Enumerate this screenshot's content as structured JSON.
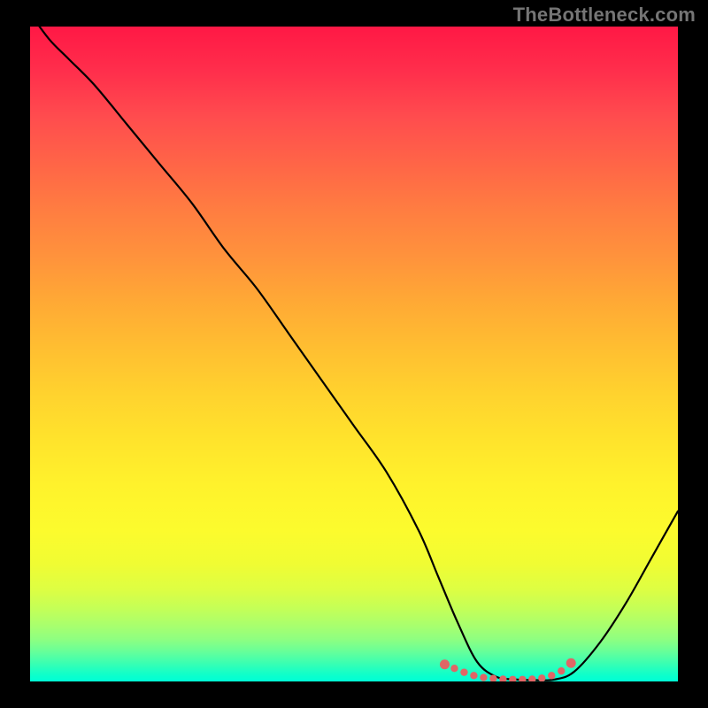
{
  "watermark": "TheBottleneck.com",
  "chart_data": {
    "type": "line",
    "title": "",
    "xlabel": "",
    "ylabel": "",
    "xlim": [
      0,
      100
    ],
    "ylim": [
      0,
      100
    ],
    "grid": false,
    "legend": false,
    "series": [
      {
        "name": "bottleneck-curve",
        "x": [
          0,
          3,
          6,
          10,
          15,
          20,
          25,
          30,
          35,
          40,
          45,
          50,
          55,
          60,
          63,
          66,
          69,
          72,
          75,
          78,
          81,
          84,
          88,
          92,
          96,
          100
        ],
        "y": [
          102,
          98,
          95,
          91,
          85,
          79,
          73,
          66,
          60,
          53,
          46,
          39,
          32,
          23,
          16,
          9,
          3,
          0.7,
          0.3,
          0.2,
          0.3,
          1.5,
          6,
          12,
          19,
          26
        ]
      }
    ],
    "markers": {
      "name": "bottleneck-range-dots",
      "color": "#e06666",
      "x": [
        64,
        65.5,
        67,
        68.5,
        70,
        71.5,
        73,
        74.5,
        76,
        77.5,
        79,
        80.5,
        82,
        83.5
      ],
      "y": [
        2.6,
        2.0,
        1.4,
        0.9,
        0.6,
        0.45,
        0.35,
        0.3,
        0.3,
        0.35,
        0.5,
        0.9,
        1.6,
        2.8
      ]
    },
    "gradient_background": {
      "direction": "vertical",
      "top_color": "#ff1845",
      "bottom_color": "#00ffd6",
      "meaning": "top=high bottleneck, bottom=no bottleneck"
    }
  }
}
